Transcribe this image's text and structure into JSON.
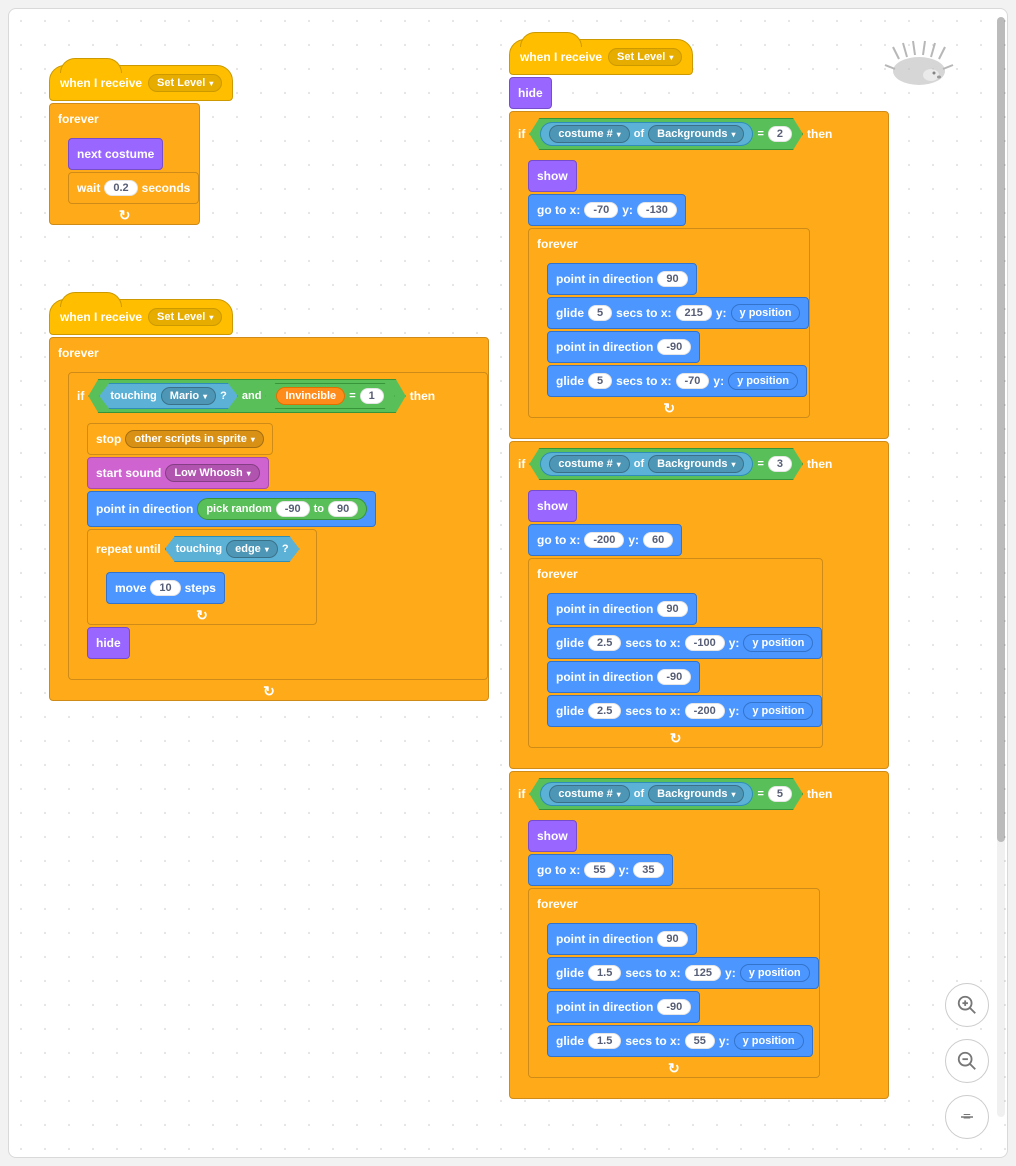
{
  "events": {
    "when_receive": "when I receive",
    "msg": "Set Level"
  },
  "control": {
    "forever": "forever",
    "wait": "wait",
    "seconds": "seconds",
    "if": "if",
    "then": "then",
    "stop": "stop",
    "stop_option": "other scripts in sprite",
    "repeat_until": "repeat until"
  },
  "looks": {
    "next_costume": "next costume",
    "hide": "hide",
    "show": "show",
    "costume_num": "costume #",
    "of": "of",
    "backgrounds": "Backgrounds"
  },
  "motion": {
    "go_to_xy": "go to x:",
    "y": "y:",
    "point_in_direction": "point in direction",
    "glide": "glide",
    "secs_to_x": "secs to x:",
    "y_position": "y position",
    "move": "move",
    "steps": "steps"
  },
  "sensing": {
    "touching": "touching",
    "mario": "Mario",
    "edge": "edge"
  },
  "operators": {
    "and": "and",
    "equals": "=",
    "pick_random": "pick random",
    "to": "to"
  },
  "data": {
    "invincible": "Invincible"
  },
  "sound": {
    "start_sound": "start sound",
    "low_whoosh": "Low Whoosh"
  },
  "script1": {
    "wait_val": "0.2"
  },
  "script2": {
    "invincible_eq": "1",
    "rand_lo": "-90",
    "rand_hi": "90",
    "move_steps": "10"
  },
  "script3": {
    "if1": {
      "eq": "2",
      "gox": "-70",
      "goy": "-130",
      "dir1": "90",
      "g1s": "5",
      "g1x": "215",
      "dir2": "-90",
      "g2s": "5",
      "g2x": "-70"
    },
    "if2": {
      "eq": "3",
      "gox": "-200",
      "goy": "60",
      "dir1": "90",
      "g1s": "2.5",
      "g1x": "-100",
      "dir2": "-90",
      "g2s": "2.5",
      "g2x": "-200"
    },
    "if3": {
      "eq": "5",
      "gox": "55",
      "goy": "35",
      "dir1": "90",
      "g1s": "1.5",
      "g1x": "125",
      "dir2": "-90",
      "g2s": "1.5",
      "g2x": "55"
    }
  },
  "zoom": {
    "in": "zoom-in",
    "out": "zoom-out",
    "reset": "zoom-reset"
  }
}
